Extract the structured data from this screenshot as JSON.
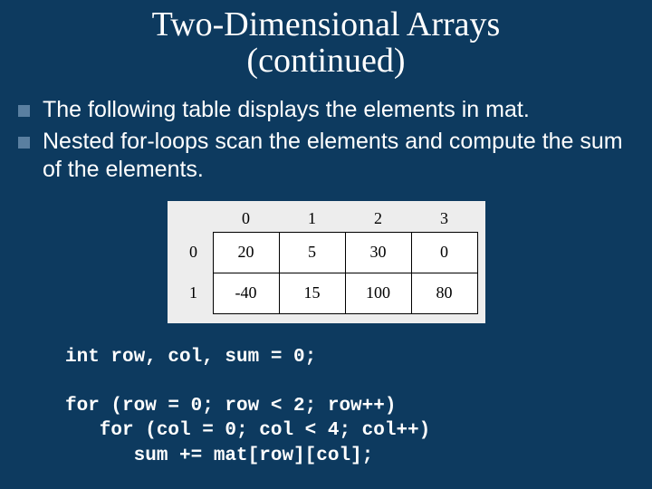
{
  "title_line1": "Two-Dimensional Arrays",
  "title_line2": "(continued)",
  "bullets": [
    "The following table displays the elements in mat.",
    "Nested for-loops scan the elements and compute the sum of the elements."
  ],
  "chart_data": {
    "type": "table",
    "col_headers": [
      "0",
      "1",
      "2",
      "3"
    ],
    "row_headers": [
      "0",
      "1"
    ],
    "rows": [
      [
        "20",
        "5",
        "30",
        "0"
      ],
      [
        "-40",
        "15",
        "100",
        "80"
      ]
    ],
    "title": "",
    "xlabel": "",
    "ylabel": ""
  },
  "code": "int row, col, sum = 0;\n\nfor (row = 0; row < 2; row++)\n   for (col = 0; col < 4; col++)\n      sum += mat[row][col];"
}
